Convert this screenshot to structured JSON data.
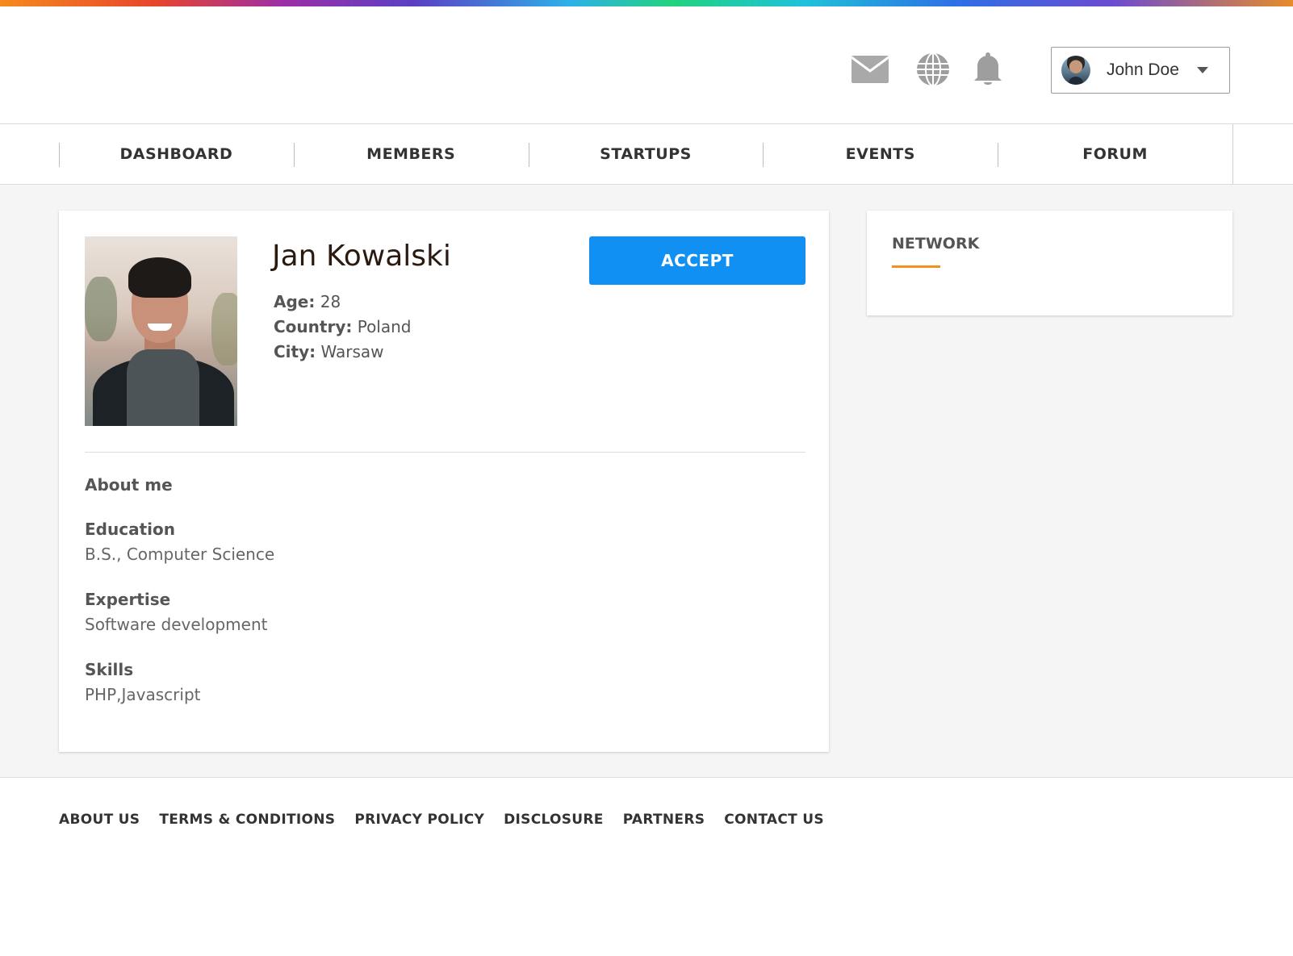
{
  "header": {
    "icons": [
      "mail-icon",
      "globe-icon",
      "bell-icon"
    ],
    "user": {
      "name": "John Doe"
    }
  },
  "nav": {
    "items": [
      {
        "label": "DASHBOARD"
      },
      {
        "label": "MEMBERS"
      },
      {
        "label": "STARTUPS"
      },
      {
        "label": "EVENTS"
      },
      {
        "label": "FORUM"
      }
    ]
  },
  "profile": {
    "name": "Jan Kowalski",
    "facts": [
      {
        "label": "Age:",
        "value": "28"
      },
      {
        "label": "Country:",
        "value": "Poland"
      },
      {
        "label": "City:",
        "value": "Warsaw"
      }
    ],
    "accept_label": "ACCEPT",
    "about_title": "About me",
    "sections": [
      {
        "label": "Education",
        "value": "B.S., Computer Science"
      },
      {
        "label": "Expertise",
        "value": "Software development"
      },
      {
        "label": "Skills",
        "value": "PHP,Javascript"
      }
    ]
  },
  "network": {
    "title": "NETWORK"
  },
  "footer": {
    "links": [
      {
        "label": "ABOUT US"
      },
      {
        "label": "TERMS & CONDITIONS"
      },
      {
        "label": "PRIVACY POLICY"
      },
      {
        "label": "DISCLOSURE"
      },
      {
        "label": "PARTNERS"
      },
      {
        "label": "CONTACT US"
      }
    ]
  },
  "colors": {
    "accent_blue": "#1090f3",
    "accent_orange": "#f5901e",
    "text_dark": "#333333",
    "page_bg": "#f5f5f5"
  }
}
